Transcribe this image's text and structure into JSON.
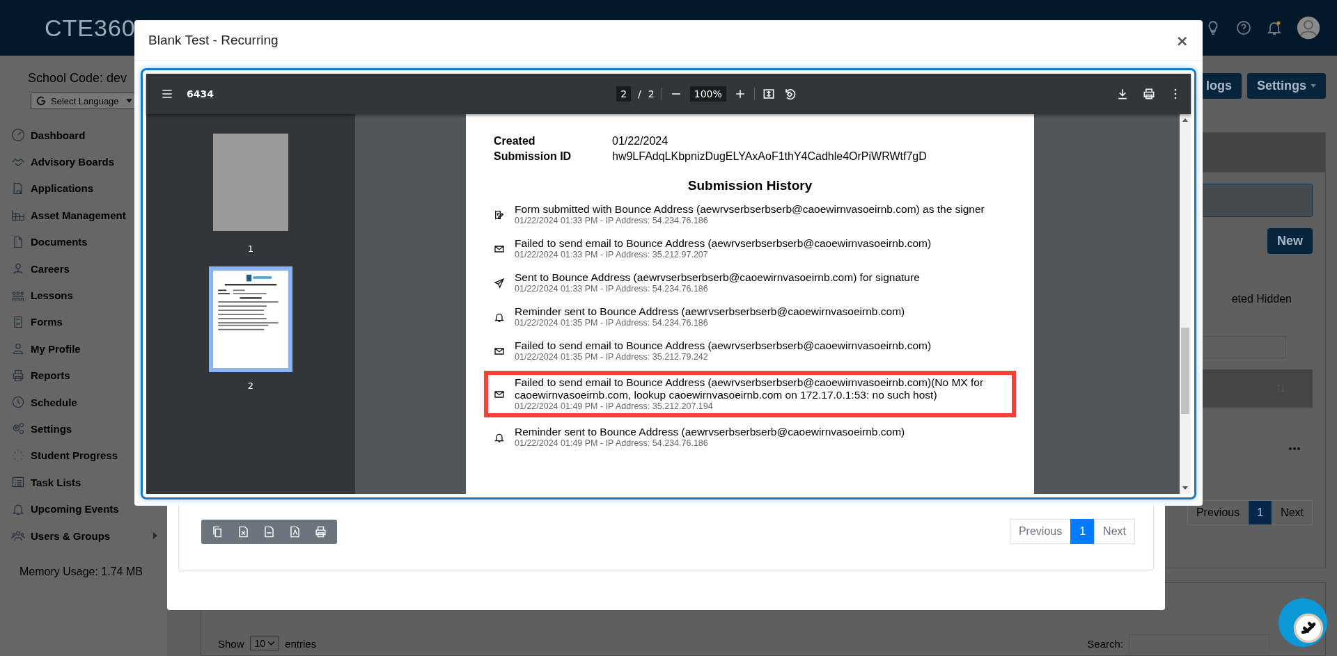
{
  "navbar": {
    "logo": "CTE360"
  },
  "sidebar": {
    "school_code": "School Code: dev",
    "language_select": "Select Language",
    "items": [
      {
        "label": "Dashboard",
        "expandable": false
      },
      {
        "label": "Advisory Boards",
        "expandable": false
      },
      {
        "label": "Applications",
        "expandable": false
      },
      {
        "label": "Asset Management",
        "expandable": false
      },
      {
        "label": "Documents",
        "expandable": false
      },
      {
        "label": "Careers",
        "expandable": false
      },
      {
        "label": "Lessons",
        "expandable": false
      },
      {
        "label": "Forms",
        "expandable": false
      },
      {
        "label": "My Profile",
        "expandable": false
      },
      {
        "label": "Reports",
        "expandable": false
      },
      {
        "label": "Schedule",
        "expandable": false
      },
      {
        "label": "Settings",
        "expandable": false
      },
      {
        "label": "Student Progress",
        "expandable": false
      },
      {
        "label": "Task Lists",
        "expandable": false
      },
      {
        "label": "Upcoming Events",
        "expandable": false
      },
      {
        "label": "Users & Groups",
        "expandable": true
      }
    ],
    "memory_usage": "Memory Usage: 1.74 MB"
  },
  "background": {
    "header_buttons": [
      "logs",
      "Settings"
    ],
    "new_button": "New",
    "filter_text": "eted Hidden",
    "pagination": {
      "previous": "Previous",
      "pages": [
        {
          "label": "1",
          "selected": true
        }
      ],
      "next": "Next"
    },
    "show_entries": {
      "show": "Show",
      "value": "10",
      "entries": "entries"
    },
    "search_label": "Search:"
  },
  "outer_modal": {
    "pagination": {
      "previous": "Previous",
      "pages": [
        {
          "label": "1",
          "selected": true
        }
      ],
      "next": "Next"
    }
  },
  "modal": {
    "title": "Blank Test - Recurring",
    "close": "×",
    "pdf_viewer": {
      "file_name": "6434",
      "page_input": "2",
      "page_separator": "/",
      "page_total": "2",
      "zoom": "100%",
      "thumbnails": [
        {
          "label": "1",
          "selected": false,
          "kind": "blank"
        },
        {
          "label": "2",
          "selected": true,
          "kind": "report"
        }
      ],
      "page": {
        "fields": [
          {
            "label": "Created",
            "value": "01/22/2024"
          },
          {
            "label": "Submission ID",
            "value": "hw9LFAdqLKbpnizDugELYAxAoF1thY4Cadhle4OrPiWRWtf7gD"
          }
        ],
        "history_title": "Submission History",
        "history": [
          {
            "kind": "signed",
            "text": "Form submitted with Bounce Address (aewrvserbserbserb@caoewirnvasoeirnb.com) as the signer",
            "meta": "01/22/2024 01:33 PM - IP Address: 54.234.76.186",
            "highlighted": false
          },
          {
            "kind": "email",
            "text": "Failed to send email to Bounce Address (aewrvserbserbserb@caoewirnvasoeirnb.com)",
            "meta": "01/22/2024 01:33 PM - IP Address: 35.212.97.207",
            "highlighted": false
          },
          {
            "kind": "sent",
            "text": "Sent to Bounce Address (aewrvserbserbserb@caoewirnvasoeirnb.com) for signature",
            "meta": "01/22/2024 01:33 PM - IP Address: 54.234.76.186",
            "highlighted": false
          },
          {
            "kind": "reminder",
            "text": "Reminder sent to Bounce Address (aewrvserbserbserb@caoewirnvasoeirnb.com)",
            "meta": "01/22/2024 01:35 PM - IP Address: 54.234.76.186",
            "highlighted": false
          },
          {
            "kind": "email",
            "text": "Failed to send email to Bounce Address (aewrvserbserbserb@caoewirnvasoeirnb.com)",
            "meta": "01/22/2024 01:35 PM - IP Address: 35.212.79.242",
            "highlighted": false
          },
          {
            "kind": "email",
            "text": "Failed to send email to Bounce Address (aewrvserbserbserb@caoewirnvasoeirnb.com)(No MX for caoewirnvasoeirnb.com, lookup caoewirnvasoeirnb.com on 172.17.0.1:53: no such host)",
            "meta": "01/22/2024 01:49 PM - IP Address: 35.212.207.194",
            "highlighted": true
          },
          {
            "kind": "reminder",
            "text": "Reminder sent to Bounce Address (aewrvserbserbserb@caoewirnvasoeirnb.com)",
            "meta": "01/22/2024 01:49 PM - IP Address: 54.234.76.186",
            "highlighted": false
          }
        ]
      }
    }
  }
}
